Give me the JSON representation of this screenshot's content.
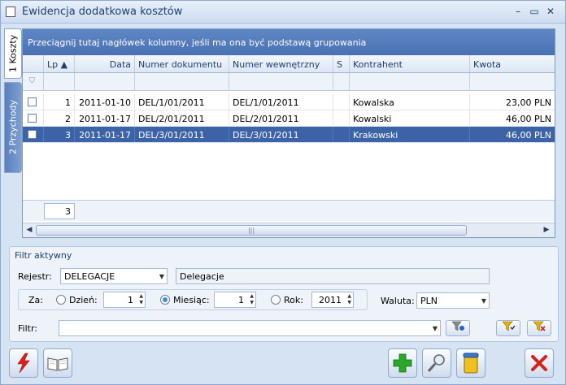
{
  "window": {
    "title": "Ewidencja dodatkowa kosztów",
    "minimize_icon": "minimize-icon",
    "maximize_icon": "maximize-icon",
    "close_icon": "close-icon"
  },
  "tabs": [
    {
      "label": "1 Koszty",
      "active": true
    },
    {
      "label": "2 Przychody",
      "active": false
    }
  ],
  "grid": {
    "group_hint": "Przeciągnij tutaj nagłówek kolumny, jeśli ma ona być podstawą grupowania",
    "columns": {
      "lp": "Lp ▲",
      "data": "Data",
      "numer_dokumentu": "Numer dokumentu",
      "numer_wewnetrzny": "Numer wewnętrzny",
      "s": "S",
      "kontrahent": "Kontrahent",
      "kwota": "Kwota"
    },
    "rows": [
      {
        "lp": "1",
        "data": "2011-01-10",
        "numer_dokumentu": "DEL/1/01/2011",
        "numer_wewnetrzny": "DEL/1/01/2011",
        "s": "",
        "kontrahent": "Kowalska",
        "kwota": "23,00 PLN",
        "selected": false
      },
      {
        "lp": "2",
        "data": "2011-01-17",
        "numer_dokumentu": "DEL/2/01/2011",
        "numer_wewnetrzny": "DEL/2/01/2011",
        "s": "",
        "kontrahent": "Kowalski",
        "kwota": "46,00 PLN",
        "selected": false
      },
      {
        "lp": "3",
        "data": "2011-01-17",
        "numer_dokumentu": "DEL/3/01/2011",
        "numer_wewnetrzny": "DEL/3/01/2011",
        "s": "",
        "kontrahent": "Krakowski",
        "kwota": "46,00 PLN",
        "selected": true
      }
    ],
    "footer_count": "3"
  },
  "filter": {
    "title": "Filtr aktywny",
    "rejestr_label": "Rejestr:",
    "rejestr_value": "DELEGACJE",
    "rejestr_desc": "Delegacje",
    "za_label": "Za:",
    "dzien_label": "Dzień:",
    "dzien_value": "1",
    "miesiac_label": "Miesiąc:",
    "miesiac_value": "1",
    "rok_label": "Rok:",
    "rok_value": "2011",
    "selected_period": "Miesiąc",
    "waluta_label": "Waluta:",
    "waluta_value": "PLN",
    "filtr_label": "Filtr:",
    "filtr_value": ""
  },
  "colors": {
    "accent": "#3c63a8",
    "header": "#4a72b3",
    "add_green": "#2aa82a",
    "close_red": "#d32020"
  }
}
